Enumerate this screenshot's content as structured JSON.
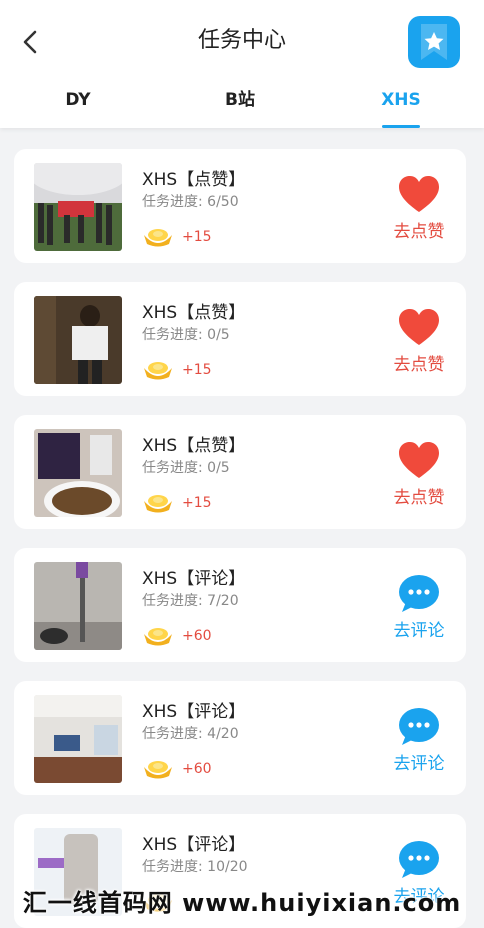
{
  "header": {
    "title": "任务中心",
    "back_icon": "chevron-left-icon",
    "bookmark_icon": "bookmark-star-icon",
    "accent_color": "#1aa3ee"
  },
  "tabs": [
    {
      "label": "DY",
      "active": false
    },
    {
      "label": "B站",
      "active": false
    },
    {
      "label": "XHS",
      "active": true
    }
  ],
  "tasks": [
    {
      "title": "XHS【点赞】",
      "progress": "任务进度: 6/50",
      "reward": "+15",
      "action": "去点赞",
      "action_icon": "heart-icon",
      "action_color": "#e34c40"
    },
    {
      "title": "XHS【点赞】",
      "progress": "任务进度: 0/5",
      "reward": "+15",
      "action": "去点赞",
      "action_icon": "heart-icon",
      "action_color": "#e34c40"
    },
    {
      "title": "XHS【点赞】",
      "progress": "任务进度: 0/5",
      "reward": "+15",
      "action": "去点赞",
      "action_icon": "heart-icon",
      "action_color": "#e34c40"
    },
    {
      "title": "XHS【评论】",
      "progress": "任务进度: 7/20",
      "reward": "+60",
      "action": "去评论",
      "action_icon": "comment-bubble-icon",
      "action_color": "#1aa3ee"
    },
    {
      "title": "XHS【评论】",
      "progress": "任务进度: 4/20",
      "reward": "+60",
      "action": "去评论",
      "action_icon": "comment-bubble-icon",
      "action_color": "#1aa3ee"
    },
    {
      "title": "XHS【评论】",
      "progress": "任务进度: 10/20",
      "reward": "",
      "action": "去评论",
      "action_icon": "comment-bubble-icon",
      "action_color": "#1aa3ee"
    }
  ],
  "watermark": "汇一线首码网 www.huiyixian.com"
}
